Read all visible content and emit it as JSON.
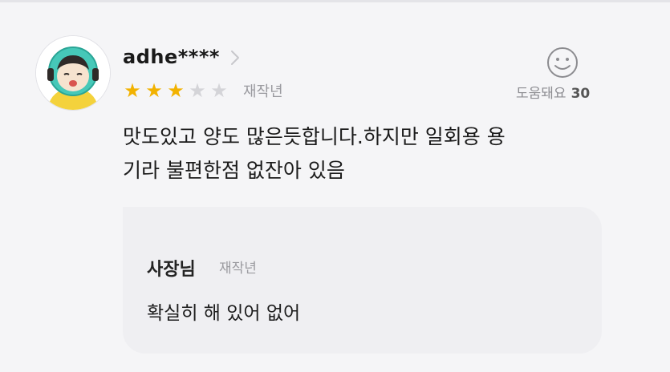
{
  "review": {
    "username": "adhe****",
    "rating": 3,
    "max_rating": 5,
    "rating_tag": "재작년",
    "helpful_label": "도움돼요",
    "helpful_count": "30",
    "text_line1": "맛도있고 양도 많은듯합니다.하지만 일회용 용",
    "text_line2": "기라 불편한점 없잔아 있음"
  },
  "reply": {
    "author": "사장님",
    "tag": "재작년",
    "text": "확실히 해 있어 없어"
  },
  "colors": {
    "star_filled": "#f2b200",
    "star_empty": "#d4d4d8",
    "background": "#f5f5f7",
    "reply_background": "#efeff2"
  },
  "icons": {
    "chevron": "chevron-right-icon",
    "helpful": "smiley-icon",
    "star": "star-icon"
  }
}
